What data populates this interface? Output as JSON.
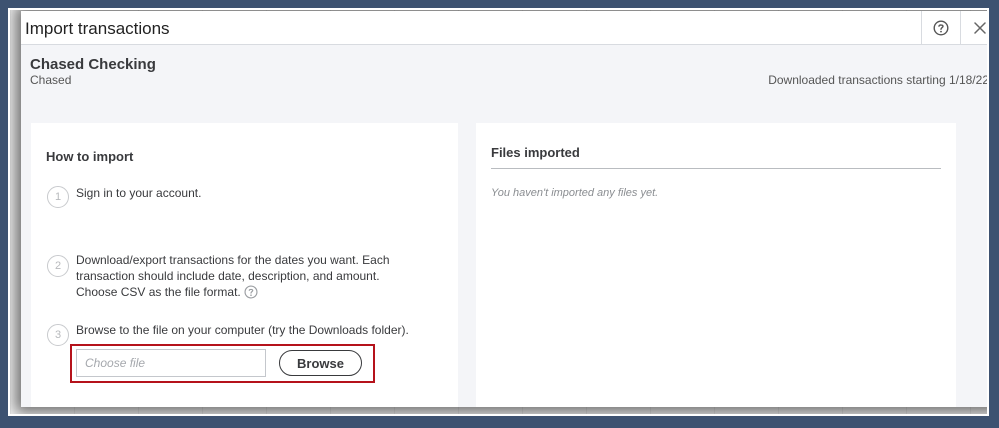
{
  "modal": {
    "title": "Import transactions",
    "help_icon": "question-circle-icon",
    "close_icon": "close-icon"
  },
  "account": {
    "name": "Chased Checking",
    "bank": "Chased",
    "downloaded_note": "Downloaded transactions starting 1/18/22"
  },
  "how_to": {
    "heading": "How to import",
    "steps": [
      {
        "number": "1",
        "text": "Sign in to your account."
      },
      {
        "number": "2",
        "text": "Download/export transactions for the dates you want. Each transaction should include date, description, and amount. Choose CSV as the file format."
      },
      {
        "number": "3",
        "text": "Browse to the file on your computer (try the Downloads folder)."
      }
    ],
    "info_icon": "question-circle-icon",
    "file_input": {
      "value": "",
      "placeholder": "Choose file"
    },
    "browse_label": "Browse",
    "highlight_color": "#b5121b"
  },
  "files": {
    "heading": "Files imported",
    "empty_text": "You haven't imported any files yet."
  }
}
